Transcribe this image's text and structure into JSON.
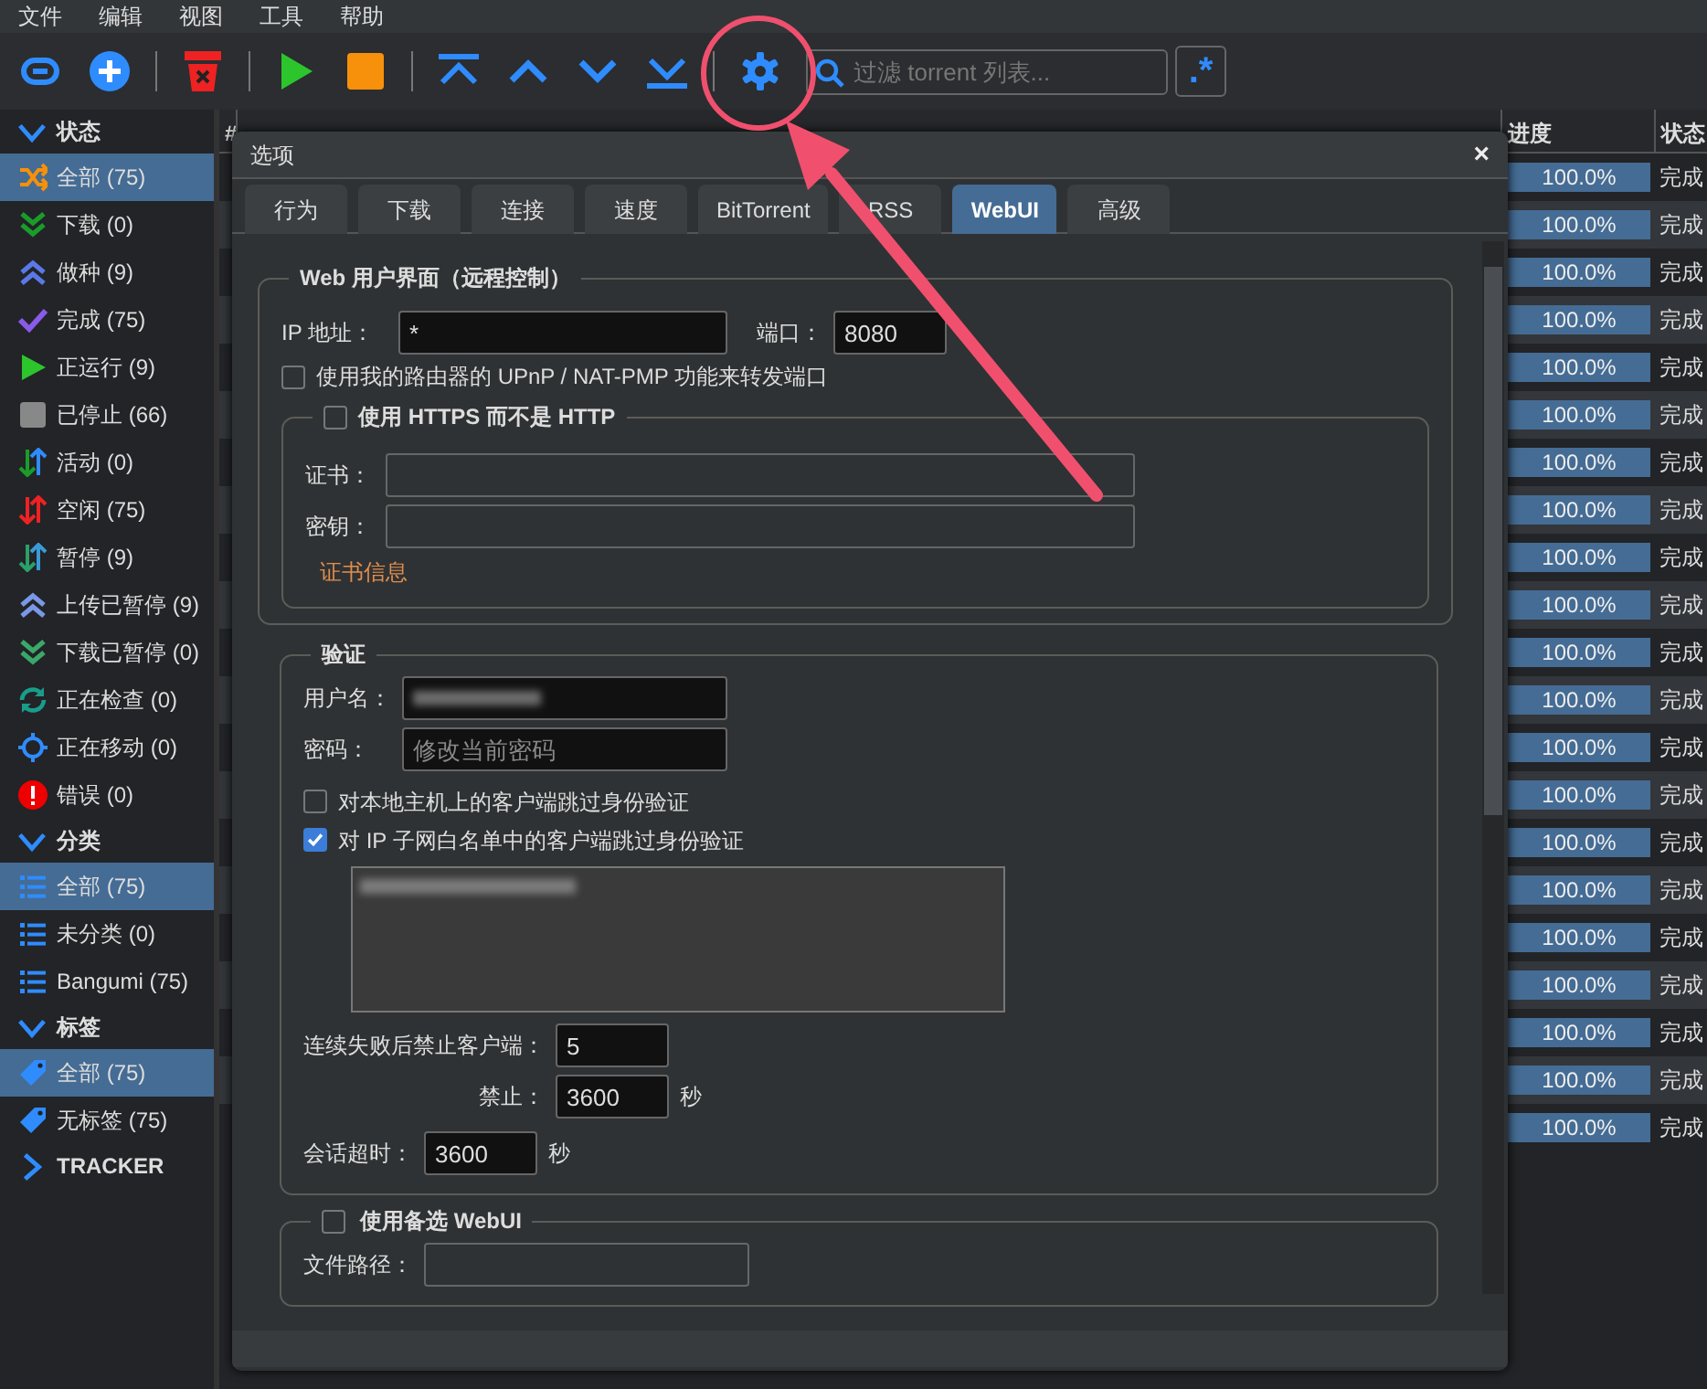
{
  "menu": [
    "文件",
    "编辑",
    "视图",
    "工具",
    "帮助"
  ],
  "filter": {
    "placeholder": "过滤 torrent 列表..."
  },
  "regex_button": ".*",
  "sidebar": [
    {
      "title": "状态",
      "expanded": true,
      "items": [
        {
          "label": "全部 (75)",
          "kind": "shuffle",
          "selected": true
        },
        {
          "label": "下载 (0)",
          "kind": "down2",
          "selected": false
        },
        {
          "label": "做种 (9)",
          "kind": "up2",
          "selected": false
        },
        {
          "label": "完成 (75)",
          "kind": "check",
          "selected": false
        },
        {
          "label": "正运行 (9)",
          "kind": "play",
          "selected": false
        },
        {
          "label": "已停止 (66)",
          "kind": "stop",
          "selected": false
        },
        {
          "label": "活动 (0)",
          "kind": "updown",
          "selected": false
        },
        {
          "label": "空闲 (75)",
          "kind": "updown-red",
          "selected": false
        },
        {
          "label": "暂停 (9)",
          "kind": "updown-teal",
          "selected": false
        },
        {
          "label": "上传已暂停 (9)",
          "kind": "up2-light",
          "selected": false
        },
        {
          "label": "下载已暂停 (0)",
          "kind": "down2-light",
          "selected": false
        },
        {
          "label": "正在检查 (0)",
          "kind": "sync",
          "selected": false
        },
        {
          "label": "正在移动 (0)",
          "kind": "target",
          "selected": false
        },
        {
          "label": "错误 (0)",
          "kind": "error",
          "selected": false
        }
      ]
    },
    {
      "title": "分类",
      "expanded": true,
      "items": [
        {
          "label": "全部 (75)",
          "kind": "list",
          "selected": true
        },
        {
          "label": "未分类 (0)",
          "kind": "list",
          "selected": false
        },
        {
          "label": "Bangumi (75)",
          "kind": "list",
          "selected": false
        }
      ]
    },
    {
      "title": "标签",
      "expanded": true,
      "items": [
        {
          "label": "全部 (75)",
          "kind": "tag",
          "selected": true
        },
        {
          "label": "无标签 (75)",
          "kind": "tag",
          "selected": false
        }
      ]
    },
    {
      "title": "TRACKER",
      "expanded": false
    }
  ],
  "table": {
    "columns": [
      "#",
      "进度",
      "状态"
    ],
    "rows": [
      {
        "progress": "100.0%",
        "level": 1,
        "status": "完成"
      },
      {
        "progress": "100.0%",
        "level": 1,
        "status": "完成"
      },
      {
        "progress": "100.0%",
        "level": 1,
        "status": "完成"
      },
      {
        "progress": "100.0%",
        "level": 1,
        "status": "完成"
      },
      {
        "progress": "100.0%",
        "level": 1,
        "status": "完成"
      },
      {
        "progress": "100.0%",
        "level": 1,
        "status": "完成"
      },
      {
        "progress": "100.0%",
        "level": 1,
        "status": "完成"
      },
      {
        "progress": "100.0%",
        "level": 1,
        "status": "完成"
      },
      {
        "progress": "100.0%",
        "level": 1,
        "status": "完成"
      },
      {
        "progress": "100.0%",
        "level": 1,
        "status": "完成"
      },
      {
        "progress": "100.0%",
        "level": 1,
        "status": "完成"
      },
      {
        "progress": "100.0%",
        "level": 1,
        "status": "完成"
      },
      {
        "progress": "100.0%",
        "level": 1,
        "status": "完成"
      },
      {
        "progress": "100.0%",
        "level": 1,
        "status": "完成"
      },
      {
        "progress": "100.0%",
        "level": 1,
        "status": "完成"
      },
      {
        "progress": "100.0%",
        "level": 1,
        "status": "完成"
      },
      {
        "progress": "100.0%",
        "level": 1,
        "status": "完成"
      },
      {
        "progress": "100.0%",
        "level": 1,
        "status": "完成"
      },
      {
        "progress": "100.0%",
        "level": 1,
        "status": "完成"
      },
      {
        "progress": "100.0%",
        "level": 1,
        "status": "完成"
      },
      {
        "progress": "100.0%",
        "level": 1,
        "status": "完成"
      }
    ]
  },
  "dialog": {
    "title": "选项",
    "close": "×",
    "tabs": [
      {
        "label": "行为",
        "selected": false
      },
      {
        "label": "下载",
        "selected": false
      },
      {
        "label": "连接",
        "selected": false
      },
      {
        "label": "速度",
        "selected": false
      },
      {
        "label": "BitTorrent",
        "selected": false
      },
      {
        "label": "RSS",
        "selected": false
      },
      {
        "label": "WebUI",
        "selected": true
      },
      {
        "label": "高级",
        "selected": false
      }
    ],
    "web_ui": {
      "legend": "Web 用户界面（远程控制）",
      "ip_label": "IP 地址：",
      "ip_value": "*",
      "port_label": "端口：",
      "port_value": "8080",
      "upnp": {
        "label": "使用我的路由器的 UPnP / NAT-PMP 功能来转发端口",
        "checked": false
      },
      "https": {
        "label": "使用 HTTPS 而不是 HTTP",
        "checked": false,
        "cert_label": "证书：",
        "key_label": "密钥：",
        "link": "证书信息"
      }
    },
    "auth": {
      "legend": "验证",
      "username_label": "用户名：",
      "password_label": "密码：",
      "password_placeholder": "修改当前密码",
      "bypass_local": {
        "label": "对本地主机上的客户端跳过身份验证",
        "checked": false
      },
      "bypass_whitelist": {
        "label": "对 IP 子网白名单中的客户端跳过身份验证",
        "checked": true
      },
      "ban_label": "连续失败后禁止客户端：",
      "ban_value": "5",
      "ban_time_label": "禁止：",
      "ban_time_value": "3600",
      "ban_time_unit": "秒",
      "session_label": "会话超时：",
      "session_value": "3600",
      "session_unit": "秒"
    },
    "alt_webui": {
      "label": "使用备选 WebUI",
      "checked": false,
      "path_label": "文件路径："
    }
  }
}
